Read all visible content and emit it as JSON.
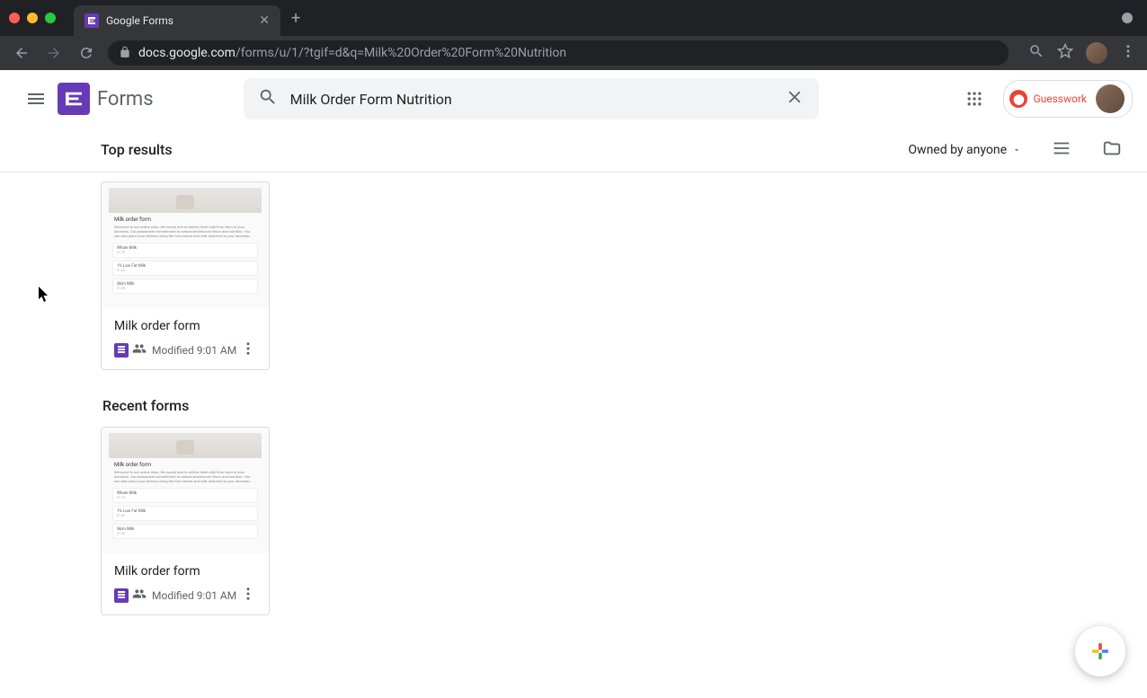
{
  "browser": {
    "tab_title": "Google Forms",
    "url_display_prefix": "docs.google.com",
    "url_display_suffix": "/forms/u/1/?tgif=d&q=Milk%20Order%20Form%20Nutrition"
  },
  "app": {
    "name": "Forms"
  },
  "search": {
    "value": "Milk Order Form Nutrition"
  },
  "extension": {
    "label": "Guesswork"
  },
  "toolbar": {
    "heading": "Top results",
    "owner_filter": "Owned by anyone"
  },
  "sections": {
    "recent_heading": "Recent forms"
  },
  "cards": {
    "top": {
      "title": "Milk order form",
      "modified": "Modified 9:01 AM",
      "preview_title": "Milk order form",
      "preview_field1": "Whole Milk",
      "preview_field2": "1% Low Fat Milk",
      "preview_field3": "Skim Milk"
    },
    "recent": {
      "title": "Milk order form",
      "modified": "Modified 9:01 AM",
      "preview_title": "Milk order form",
      "preview_field1": "Whole Milk",
      "preview_field2": "1% Low Fat Milk",
      "preview_field3": "Skim Milk"
    }
  }
}
